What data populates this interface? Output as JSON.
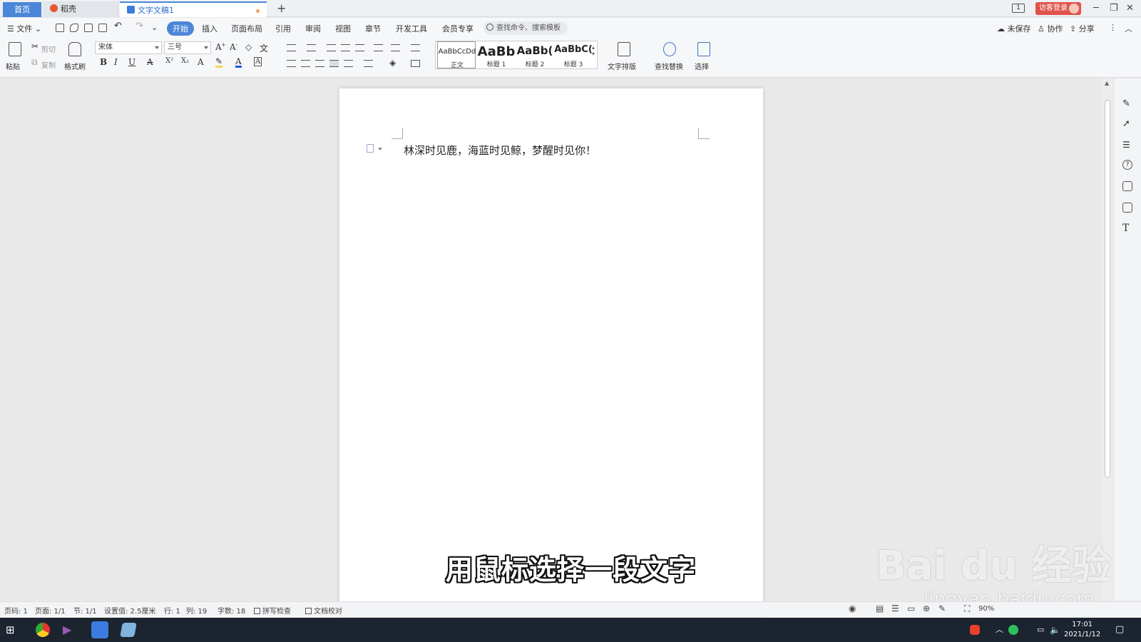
{
  "tabs": {
    "home": "首页",
    "docer": "稻壳",
    "document": "文字文稿1",
    "new_tab": "+"
  },
  "titlebar": {
    "page_counter": "1",
    "login": "访客登录",
    "minimize": "─",
    "restore": "❐",
    "close": "✕"
  },
  "menu": {
    "file": "文件",
    "items": [
      "开始",
      "插入",
      "页面布局",
      "引用",
      "审阅",
      "视图",
      "章节",
      "开发工具",
      "会员专享"
    ],
    "active_index": 0,
    "search_placeholder": "查找命令、搜索模板",
    "unsaved": "未保存",
    "collaborate": "协作",
    "share": "分享"
  },
  "ribbon": {
    "paste": "粘贴",
    "cut": "剪切",
    "copy": "复制",
    "format_painter": "格式刷",
    "font_name": "宋体",
    "font_size": "三号",
    "bold": "B",
    "italic": "I",
    "underline": "U",
    "strike": "A",
    "superscript": "X²",
    "subscript": "X₂",
    "font_effect": "A",
    "font_color": "A",
    "char_border": "A",
    "styles": [
      {
        "sample": "AaBbCcDd",
        "name": "正文"
      },
      {
        "sample": "AaBb",
        "name": "标题 1"
      },
      {
        "sample": "AaBb(",
        "name": "标题 2"
      },
      {
        "sample": "AaBbC(",
        "name": "标题 3"
      }
    ],
    "text_layout": "文字排版",
    "find_replace": "查找替换",
    "select": "选择"
  },
  "document": {
    "text": "林深时见鹿，海蓝时见鲸，梦醒时见你！"
  },
  "overlay": {
    "subtitle": "用鼠标选择一段文字",
    "watermark": "Bai du 经验",
    "watermark_url": "jingyan.baidu.com"
  },
  "statusbar": {
    "page_num": "页码: 1",
    "pages": "页面: 1/1",
    "section": "节: 1/1",
    "setting": "设置值: 2.5厘米",
    "row": "行: 1",
    "col": "列: 19",
    "words": "字数: 18",
    "spell_check": "拼写检查",
    "proofread": "文档校对",
    "zoom": "90%"
  },
  "taskbar": {
    "time": "17:01",
    "date": "2021/1/12"
  },
  "colors": {
    "accent": "#4b86d8",
    "login": "#e0534a",
    "taskbar": "#1c2430"
  }
}
